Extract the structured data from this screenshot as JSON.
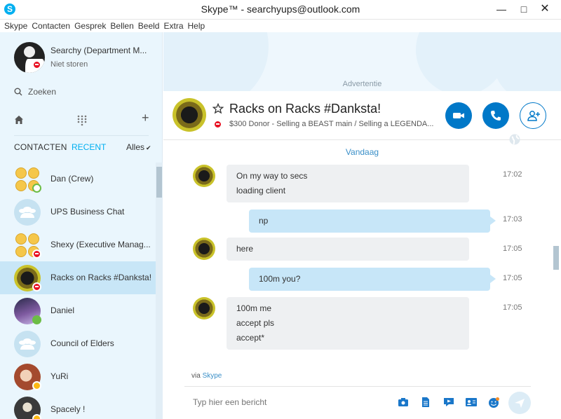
{
  "window": {
    "title": "Skype™ - searchyups@outlook.com",
    "app_logo": "S"
  },
  "menu": [
    "Skype",
    "Contacten",
    "Gesprek",
    "Bellen",
    "Beeld",
    "Extra",
    "Help"
  ],
  "profile": {
    "name": "Searchy (Department M...",
    "status": "Niet storen",
    "status_icon": "dnd-status-icon"
  },
  "search": {
    "label": "Zoeken"
  },
  "tabs": {
    "contacts": "CONTACTEN",
    "recent": "RECENT",
    "filter": "Alles"
  },
  "contacts": [
    {
      "name": "Dan (Crew)",
      "status": "online"
    },
    {
      "name": "UPS Business Chat",
      "status": "none"
    },
    {
      "name": "Shexy (Executive Manag...",
      "status": "dnd"
    },
    {
      "name": "Racks on Racks #Danksta!",
      "status": "dnd",
      "selected": true
    },
    {
      "name": "Daniel",
      "status": "online"
    },
    {
      "name": "Council of Elders",
      "status": "none"
    },
    {
      "name": "YuRi",
      "status": "away"
    },
    {
      "name": "Spacely !",
      "status": "away"
    }
  ],
  "ad": {
    "label": "Advertentie"
  },
  "chat": {
    "title": "Racks on Racks #Danksta!",
    "mood": "$300 Donor - Selling a BEAST main / Selling a LEGENDA...",
    "date_divider": "Vandaag",
    "messages": [
      {
        "dir": "in",
        "lines": [
          "On my way to secs",
          "loading client"
        ],
        "time": "17:02"
      },
      {
        "dir": "out",
        "lines": [
          "np"
        ],
        "time": "17:03"
      },
      {
        "dir": "in",
        "lines": [
          "here"
        ],
        "time": "17:05"
      },
      {
        "dir": "out",
        "lines": [
          "100m you?"
        ],
        "time": "17:05"
      },
      {
        "dir": "in",
        "lines": [
          "100m me",
          "accept pls",
          "accept*"
        ],
        "time": "17:05"
      }
    ],
    "via_prefix": "via",
    "via_link": "Skype",
    "input_placeholder": "Typ hier een bericht"
  },
  "colors": {
    "accent": "#00aff0",
    "button_blue": "#0078c8",
    "dnd": "#e81123",
    "sidebar_bg": "#eaf6fd"
  }
}
